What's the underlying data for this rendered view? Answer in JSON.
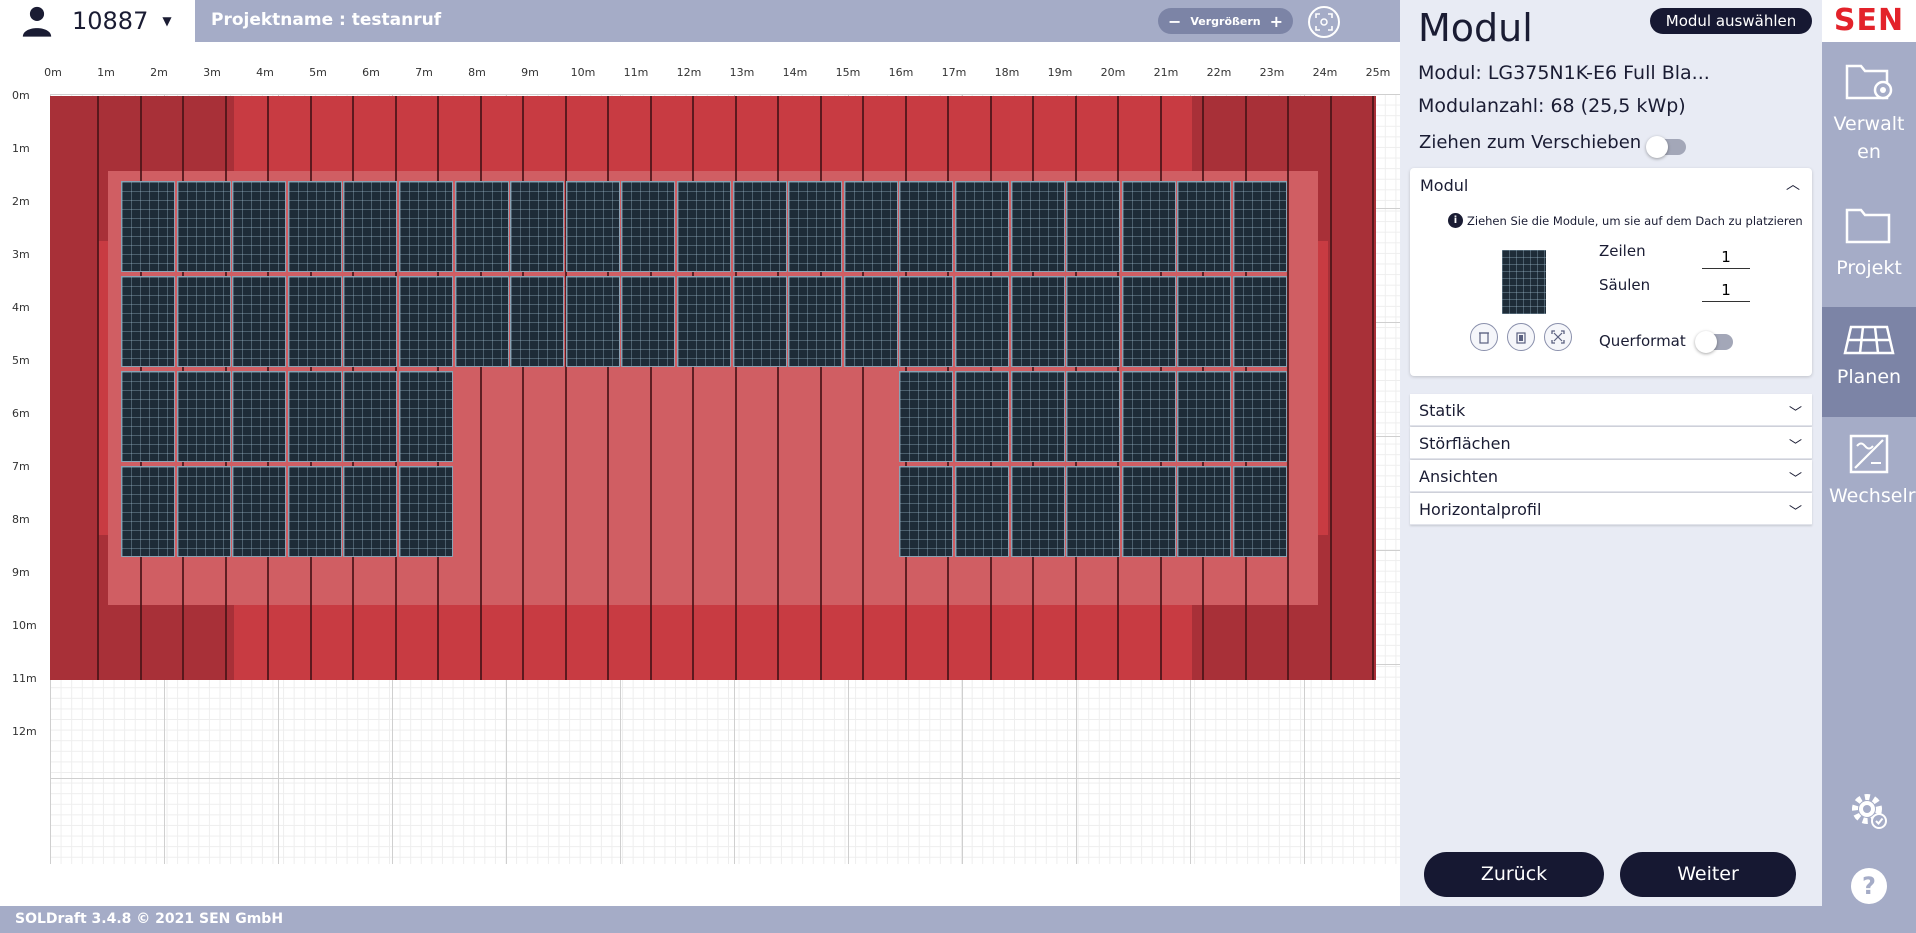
{
  "header": {
    "user_id": "10887",
    "project_name": "Projektname : testanruf",
    "zoom_label": "Vergrößern",
    "zoom_minus": "−",
    "zoom_plus": "+"
  },
  "ruler": {
    "x_labels": [
      "0m",
      "1m",
      "2m",
      "3m",
      "4m",
      "5m",
      "6m",
      "7m",
      "8m",
      "9m",
      "10m",
      "11m",
      "12m",
      "13m",
      "14m",
      "15m",
      "16m",
      "17m",
      "18m",
      "19m",
      "20m",
      "21m",
      "22m",
      "23m",
      "24m",
      "25m"
    ],
    "y_labels": [
      "0m",
      "1m",
      "2m",
      "3m",
      "4m",
      "5m",
      "6m",
      "7m",
      "8m",
      "9m",
      "10m",
      "11m",
      "12m"
    ]
  },
  "roof": {
    "color": "#c83b42",
    "edge_color": "#a83038",
    "inner_color": "#d05e63",
    "module_color": "#1e2c38",
    "module_rows": [
      {
        "row": 1,
        "columns": 21
      },
      {
        "row": 2,
        "columns": 21
      },
      {
        "row": 3,
        "left_columns": 6,
        "right_columns": 7
      },
      {
        "row": 4,
        "left_columns": 6,
        "right_columns": 7
      }
    ]
  },
  "panel": {
    "title": "Modul",
    "select_button": "Modul auswählen",
    "module_name": "Modul: LG375N1K-E6 Full Bla...",
    "module_count": "Modulanzahl: 68 (25,5 kWp)",
    "drag_label": "Ziehen zum Verschieben",
    "drag_toggle_on": false,
    "modul_section": {
      "header": "Modul",
      "hint": "Ziehen Sie die Module, um sie auf dem Dach zu platzieren",
      "rows_label": "Zeilen",
      "rows_value": "1",
      "cols_label": "Säulen",
      "cols_value": "1",
      "landscape_label": "Querformat",
      "landscape_on": false
    },
    "accordion": [
      "Statik",
      "Störflächen",
      "Ansichten",
      "Horizontalprofil"
    ],
    "back_button": "Zurück",
    "next_button": "Weiter"
  },
  "sidenav": {
    "logo": "SEN",
    "items": [
      "Verwalten",
      "Projekt",
      "Planen",
      "Wechselrichter"
    ],
    "active": "Planen",
    "help": "?"
  },
  "footer": {
    "text": "SOLDraft 3.4.8 © 2021 SEN GmbH"
  }
}
